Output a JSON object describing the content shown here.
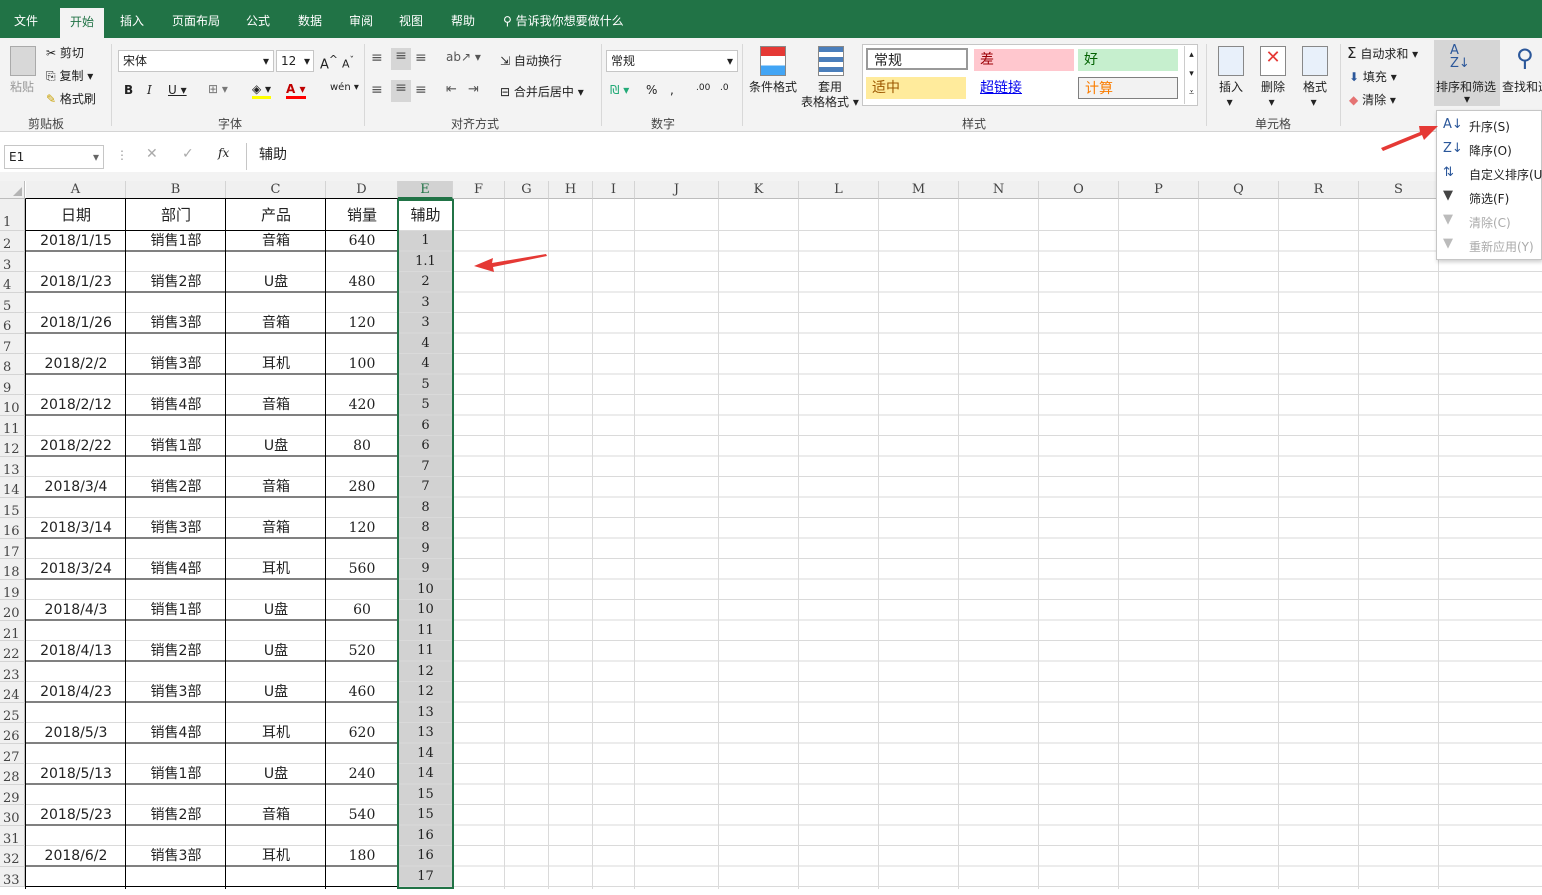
{
  "tabs": [
    "文件",
    "开始",
    "插入",
    "页面布局",
    "公式",
    "数据",
    "审阅",
    "视图",
    "帮助"
  ],
  "tell_me": "告诉我你想要做什么",
  "clipboard": {
    "paste": "粘贴",
    "cut": "剪切",
    "copy": "复制",
    "painter": "格式刷",
    "group": "剪贴板"
  },
  "font": {
    "name": "宋体",
    "size": "12",
    "group": "字体"
  },
  "align": {
    "wrap": "自动换行",
    "merge": "合并后居中",
    "group": "对齐方式"
  },
  "number": {
    "format": "常规",
    "group": "数字"
  },
  "styles": {
    "cond": "条件格式",
    "table1": "套用",
    "table2": "表格格式",
    "normal": "常规",
    "bad": "差",
    "good": "好",
    "neutral": "适中",
    "hyperlink": "超链接",
    "calc": "计算",
    "group": "样式"
  },
  "cells": {
    "insert": "插入",
    "delete": "删除",
    "format": "格式",
    "group": "单元格"
  },
  "editing": {
    "autosum": "自动求和",
    "fill": "填充",
    "clear": "清除",
    "sort": "排序和筛选",
    "find": "查找和选"
  },
  "namebox": "E1",
  "formula": "辅助",
  "columns": [
    "A",
    "B",
    "C",
    "D",
    "E",
    "F",
    "G",
    "H",
    "I",
    "J",
    "K",
    "L",
    "M",
    "N",
    "O",
    "P",
    "Q",
    "R",
    "S"
  ],
  "rows": [
    "1",
    "2",
    "3",
    "4",
    "5",
    "6",
    "7",
    "8",
    "9",
    "10",
    "11",
    "12",
    "13",
    "14",
    "15",
    "16",
    "17",
    "18",
    "19",
    "20",
    "21",
    "22",
    "23",
    "24",
    "25",
    "26",
    "27",
    "28",
    "29",
    "30",
    "31",
    "32",
    "33"
  ],
  "table": {
    "headers": [
      "日期",
      "部门",
      "产品",
      "销量",
      "辅助"
    ],
    "data": [
      [
        "2018/1/15",
        "销售1部",
        "音箱",
        "640",
        "1"
      ],
      [
        "",
        "",
        "",
        "",
        "1.1"
      ],
      [
        "2018/1/23",
        "销售2部",
        "U盘",
        "480",
        "2"
      ],
      [
        "",
        "",
        "",
        "",
        "3"
      ],
      [
        "2018/1/26",
        "销售3部",
        "音箱",
        "120",
        "3"
      ],
      [
        "",
        "",
        "",
        "",
        "4"
      ],
      [
        "2018/2/2",
        "销售3部",
        "耳机",
        "100",
        "4"
      ],
      [
        "",
        "",
        "",
        "",
        "5"
      ],
      [
        "2018/2/12",
        "销售4部",
        "音箱",
        "420",
        "5"
      ],
      [
        "",
        "",
        "",
        "",
        "6"
      ],
      [
        "2018/2/22",
        "销售1部",
        "U盘",
        "80",
        "6"
      ],
      [
        "",
        "",
        "",
        "",
        "7"
      ],
      [
        "2018/3/4",
        "销售2部",
        "音箱",
        "280",
        "7"
      ],
      [
        "",
        "",
        "",
        "",
        "8"
      ],
      [
        "2018/3/14",
        "销售3部",
        "音箱",
        "120",
        "8"
      ],
      [
        "",
        "",
        "",
        "",
        "9"
      ],
      [
        "2018/3/24",
        "销售4部",
        "耳机",
        "560",
        "9"
      ],
      [
        "",
        "",
        "",
        "",
        "10"
      ],
      [
        "2018/4/3",
        "销售1部",
        "U盘",
        "60",
        "10"
      ],
      [
        "",
        "",
        "",
        "",
        "11"
      ],
      [
        "2018/4/13",
        "销售2部",
        "U盘",
        "520",
        "11"
      ],
      [
        "",
        "",
        "",
        "",
        "12"
      ],
      [
        "2018/4/23",
        "销售3部",
        "U盘",
        "460",
        "12"
      ],
      [
        "",
        "",
        "",
        "",
        "13"
      ],
      [
        "2018/5/3",
        "销售4部",
        "耳机",
        "620",
        "13"
      ],
      [
        "",
        "",
        "",
        "",
        "14"
      ],
      [
        "2018/5/13",
        "销售1部",
        "U盘",
        "240",
        "14"
      ],
      [
        "",
        "",
        "",
        "",
        "15"
      ],
      [
        "2018/5/23",
        "销售2部",
        "音箱",
        "540",
        "15"
      ],
      [
        "",
        "",
        "",
        "",
        "16"
      ],
      [
        "2018/6/2",
        "销售3部",
        "耳机",
        "180",
        "16"
      ],
      [
        "",
        "",
        "",
        "",
        "17"
      ]
    ]
  },
  "sort_menu": [
    {
      "label": "升序(S)",
      "icon": "sort-ascending-icon",
      "enabled": true
    },
    {
      "label": "降序(O)",
      "icon": "sort-descending-icon",
      "enabled": true
    },
    {
      "label": "自定义排序(U)",
      "icon": "custom-sort-icon",
      "enabled": true
    },
    {
      "label": "筛选(F)",
      "icon": "filter-icon",
      "enabled": true
    },
    {
      "label": "清除(C)",
      "icon": "clear-filter-icon",
      "enabled": false
    },
    {
      "label": "重新应用(Y)",
      "icon": "reapply-icon",
      "enabled": false
    }
  ],
  "colors": {
    "brand": "#217346",
    "arrow": "#e53935",
    "bad_bg": "#ffc7ce",
    "good_bg": "#c6efce",
    "neutral_bg": "#ffeb9c",
    "calc_bg": "#f2f2f2"
  }
}
